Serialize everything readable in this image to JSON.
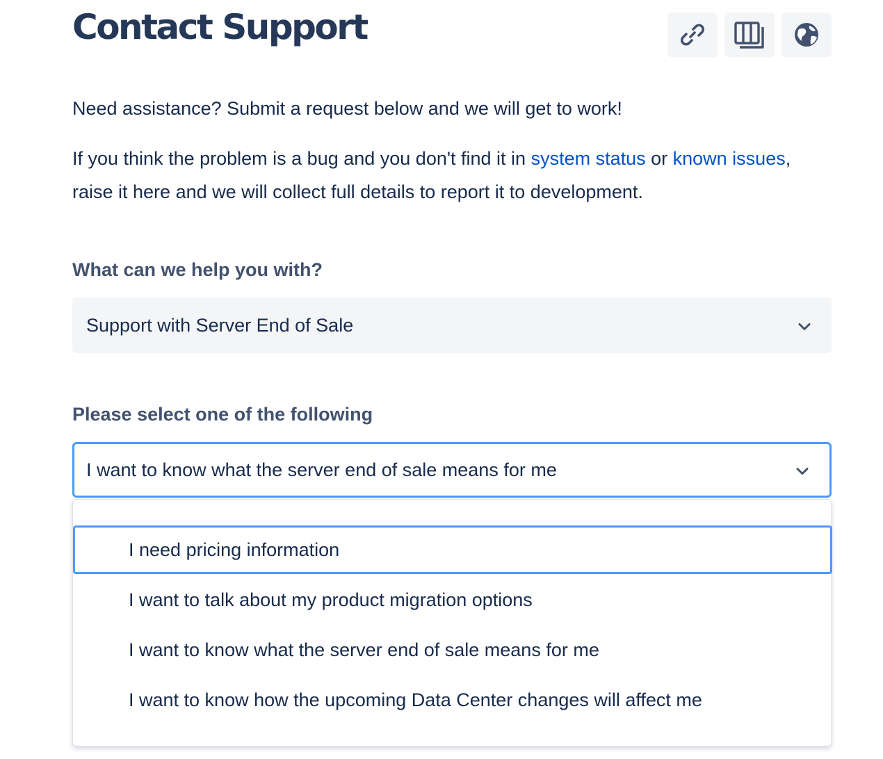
{
  "header": {
    "title": "Contact Support",
    "icons": [
      "link-icon",
      "columns-icon",
      "globe-icon"
    ]
  },
  "intro": {
    "line1": "Need assistance? Submit a request below and we will get to work!",
    "line2_pre": "If you think the problem is a bug and you don't find it in ",
    "link_status": "system status",
    "line2_mid": " or ",
    "link_known": "known issues",
    "line2_post": ", raise it here and we will collect full details to report it to development."
  },
  "help_field": {
    "label": "What can we help you with?",
    "value": "Support with Server End of Sale"
  },
  "select_field": {
    "label": "Please select one of the following",
    "value": "I want to know what the server end of sale means for me",
    "options": [
      "I need pricing information",
      "I want to talk about my product migration options",
      "I want to know what the server end of sale means for me",
      "I want to know how the upcoming Data Center changes will affect me"
    ]
  },
  "colors": {
    "text": "#172b4d",
    "title": "#253858",
    "label": "#42526e",
    "link": "#0052cc",
    "focus": "#4c9aff",
    "field_bg": "#f4f5f7"
  }
}
